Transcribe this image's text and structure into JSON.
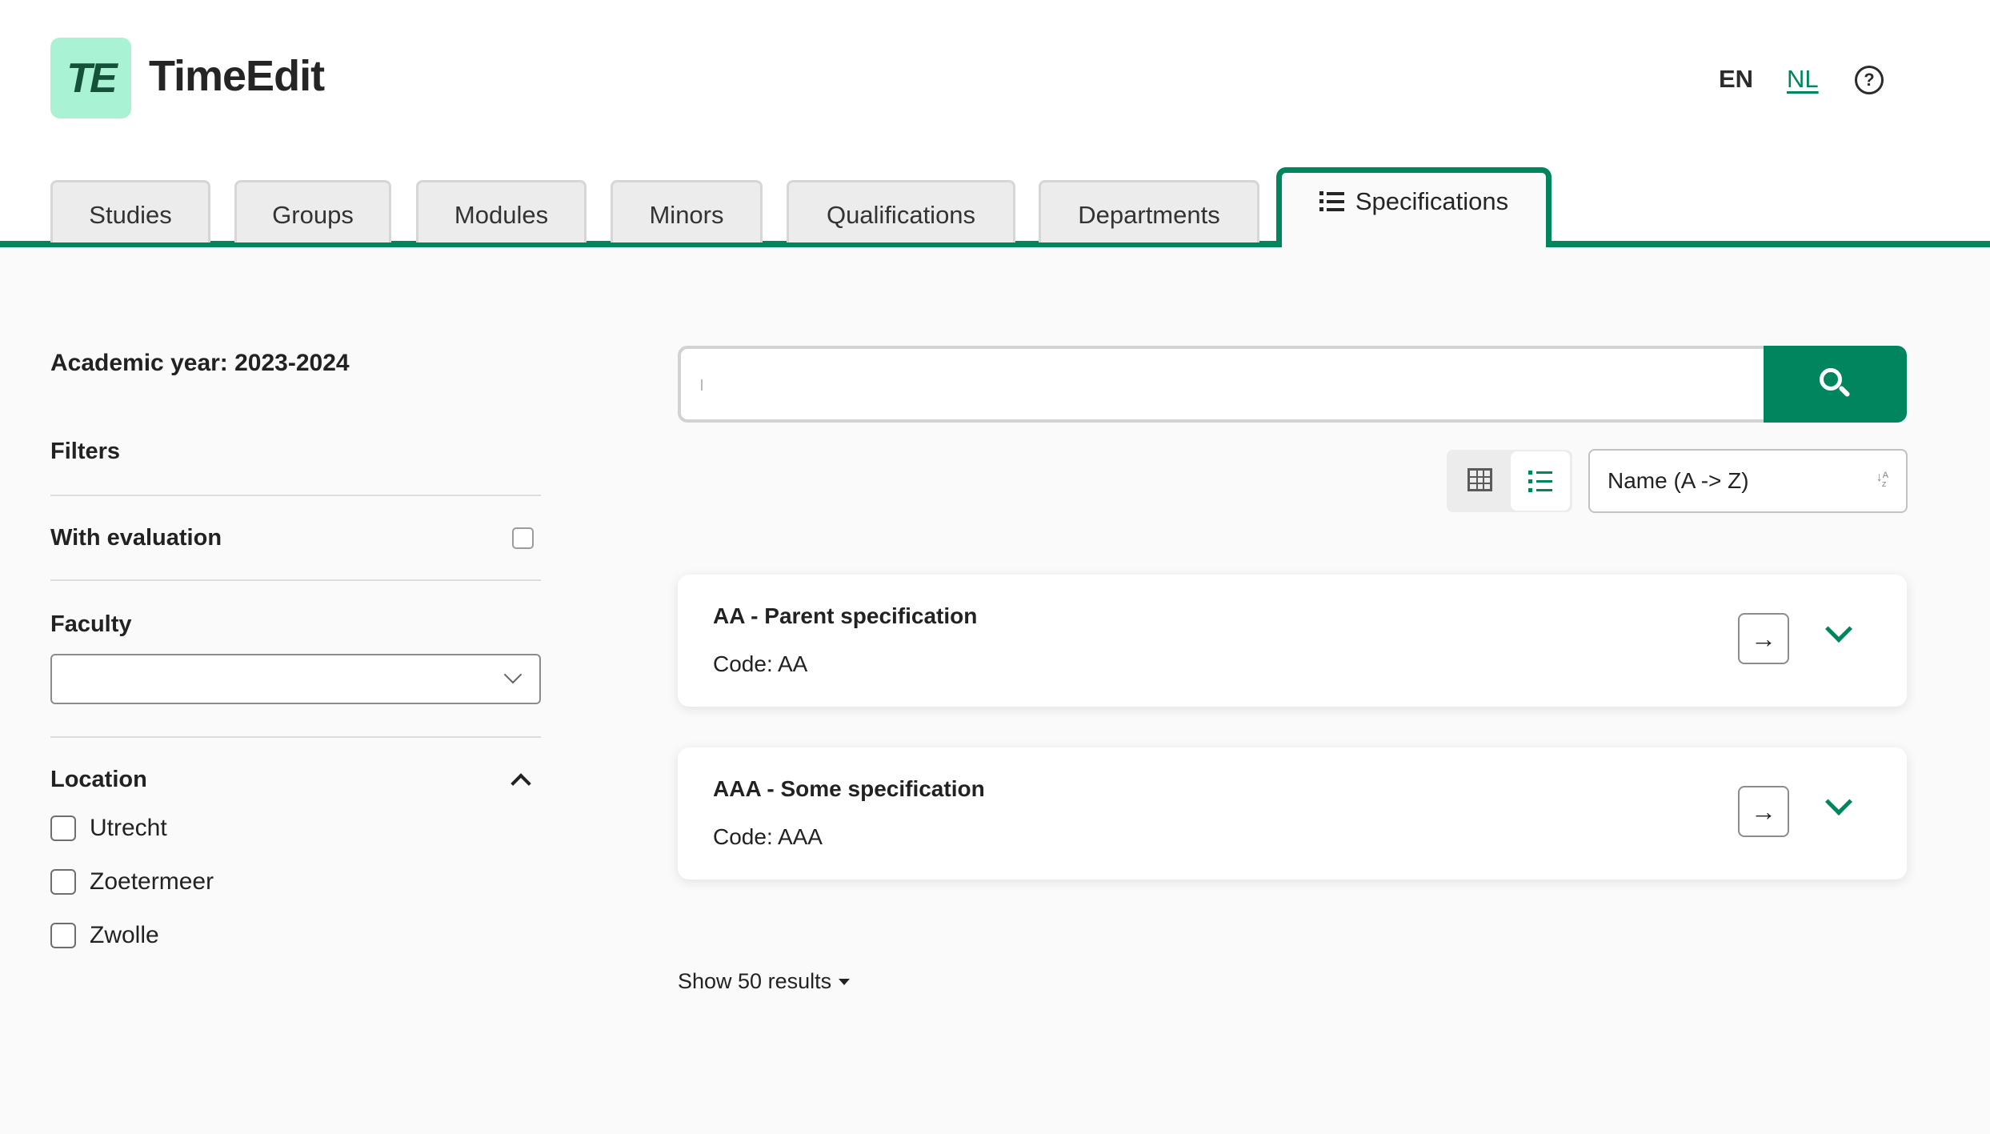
{
  "header": {
    "logo_text": "TE",
    "brand": "TimeEdit",
    "lang_en": "EN",
    "lang_nl": "NL",
    "help_icon": "?"
  },
  "tabs": [
    {
      "label": "Studies"
    },
    {
      "label": "Groups"
    },
    {
      "label": "Modules"
    },
    {
      "label": "Minors"
    },
    {
      "label": "Qualifications"
    },
    {
      "label": "Departments"
    },
    {
      "label": "Specifications",
      "active": true
    }
  ],
  "sidebar": {
    "academic_year": "Academic year: 2023-2024",
    "filters_title": "Filters",
    "with_evaluation": "With evaluation",
    "faculty_label": "Faculty",
    "faculty_value": "",
    "location_label": "Location",
    "locations": [
      "Utrecht",
      "Zoetermeer",
      "Zwolle"
    ]
  },
  "search": {
    "value": "",
    "placeholder": ""
  },
  "sort": {
    "selected": "Name (A -> Z)"
  },
  "results": [
    {
      "title": "AA - Parent specification",
      "code": "Code: AA"
    },
    {
      "title": "AAA - Some specification",
      "code": "Code: AAA"
    }
  ],
  "pagination": {
    "show_results": "Show 50 results"
  },
  "colors": {
    "accent": "#00855f",
    "logo_bg": "#a9f2d4",
    "page_bg": "#fafafa"
  },
  "icons": {
    "search": "search-icon",
    "grid_view": "grid-view-icon",
    "list_view": "list-view-icon",
    "sort": "sort-alpha-icon",
    "open": "arrow-right-icon",
    "expand": "chevron-down-icon",
    "collapse": "chevron-up-icon",
    "help": "help-circle-icon"
  }
}
